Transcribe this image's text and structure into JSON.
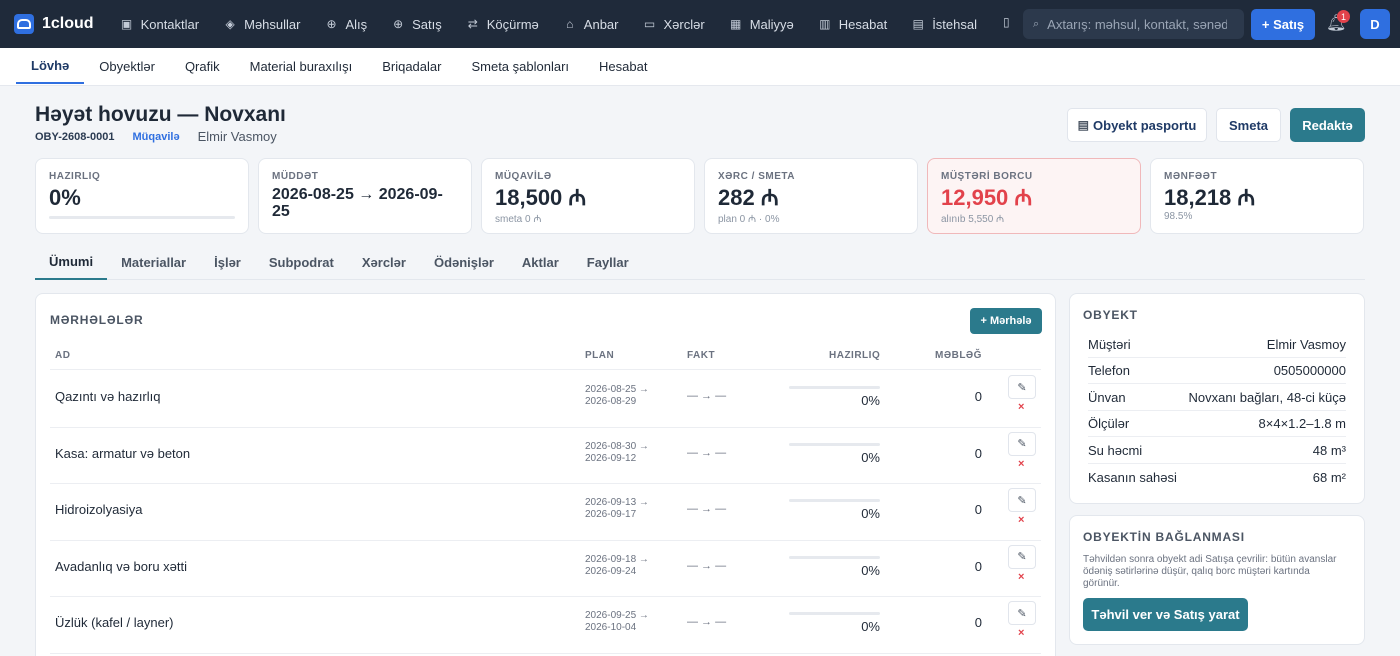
{
  "app": {
    "brand": "1cloud"
  },
  "topnav": [
    {
      "label": "Kontaktlar",
      "icon": "contacts-icon",
      "glyph": "▣"
    },
    {
      "label": "Məhsullar",
      "icon": "box-icon",
      "glyph": "◈"
    },
    {
      "label": "Alış",
      "icon": "arrow-down-circle-icon",
      "glyph": "⊕"
    },
    {
      "label": "Satış",
      "icon": "arrow-up-circle-icon",
      "glyph": "⊕"
    },
    {
      "label": "Köçürmə",
      "icon": "transfer-icon",
      "glyph": "⇄"
    },
    {
      "label": "Anbar",
      "icon": "warehouse-icon",
      "glyph": "⌂"
    },
    {
      "label": "Xərclər",
      "icon": "card-icon",
      "glyph": "▭"
    },
    {
      "label": "Maliyyə",
      "icon": "grid-icon",
      "glyph": "▦"
    },
    {
      "label": "Hesabat",
      "icon": "report-icon",
      "glyph": "▥"
    },
    {
      "label": "İstehsal",
      "icon": "factory-icon",
      "glyph": "▤"
    }
  ],
  "search": {
    "placeholder": "Axtarış: məhsul, kontakt, sənəd..."
  },
  "sale_button": "+ Satış",
  "notifications": {
    "count": "1"
  },
  "user": {
    "initial": "D"
  },
  "subnav": [
    "Lövhə",
    "Obyektlər",
    "Qrafik",
    "Material buraxılışı",
    "Briqadalar",
    "Smeta şablonları",
    "Hesabat"
  ],
  "header": {
    "title": "Həyət hovuzu — Novxanı",
    "code": "OBY-2608-0001",
    "status": "Müqavilə",
    "client": "Elmir Vasmoy",
    "btn_passport": "Obyekt pasportu",
    "btn_estimate": "Smeta",
    "btn_edit": "Redaktə"
  },
  "kpis": [
    {
      "label": "HAZIRLIQ",
      "value": "0%",
      "progress": 0
    },
    {
      "label": "MÜDDƏT",
      "value": "2026-08-25 → 2026-09-25"
    },
    {
      "label": "MÜQAVİLƏ",
      "value": "18,500 ₼",
      "sub": "smeta 0 ₼"
    },
    {
      "label": "XƏRC / SMETA",
      "value": "282 ₼",
      "sub": "plan 0 ₼ · 0%"
    },
    {
      "label": "MÜŞTƏRİ BORCU",
      "value": "12,950 ₼",
      "sub": "alınıb 5,550 ₼"
    },
    {
      "label": "MƏNFƏƏT",
      "value": "18,218 ₼",
      "sub": "98.5%"
    }
  ],
  "tabs": [
    "Ümumi",
    "Materiallar",
    "İşlər",
    "Subpodrat",
    "Xərclər",
    "Ödənişlər",
    "Aktlar",
    "Fayllar"
  ],
  "phases": {
    "title": "MƏRHƏLƏLƏR",
    "add_label": "+ Mərhələ",
    "headers": {
      "name": "AD",
      "plan": "PLAN",
      "fact": "FAKT",
      "ready": "HAZIRLIQ",
      "amount": "MƏBLƏĞ"
    },
    "rows": [
      {
        "name": "Qazıntı və hazırlıq",
        "plan_from": "2026-08-25 →",
        "plan_to": "2026-08-29",
        "fact": "— → —",
        "progress": 0,
        "pct": "0%",
        "amount": "0"
      },
      {
        "name": "Kasa: armatur və beton",
        "plan_from": "2026-08-30 →",
        "plan_to": "2026-09-12",
        "fact": "— → —",
        "progress": 0,
        "pct": "0%",
        "amount": "0"
      },
      {
        "name": "Hidroizolyasiya",
        "plan_from": "2026-09-13 →",
        "plan_to": "2026-09-17",
        "fact": "— → —",
        "progress": 0,
        "pct": "0%",
        "amount": "0"
      },
      {
        "name": "Avadanlıq və boru xətti",
        "plan_from": "2026-09-18 →",
        "plan_to": "2026-09-24",
        "fact": "— → —",
        "progress": 0,
        "pct": "0%",
        "amount": "0"
      },
      {
        "name": "Üzlük (kafel / layner)",
        "plan_from": "2026-09-25 →",
        "plan_to": "2026-10-04",
        "fact": "— → —",
        "progress": 0,
        "pct": "0%",
        "amount": "0"
      }
    ],
    "edit_glyph": "✎",
    "delete_glyph": "×"
  },
  "object": {
    "title": "OBYEKT",
    "rows": [
      {
        "key": "Müştəri",
        "value": "Elmir Vasmoy"
      },
      {
        "key": "Telefon",
        "value": "0505000000"
      },
      {
        "key": "Ünvan",
        "value": "Novxanı bağları, 48-ci küçə"
      },
      {
        "key": "Ölçülər",
        "value": "8×4×1.2–1.8 m"
      },
      {
        "key": "Su həcmi",
        "value": "48 m³"
      },
      {
        "key": "Kasanın sahəsi",
        "value": "68 m²"
      }
    ]
  },
  "link": {
    "title": "OBYEKTİN BAĞLANMASI",
    "desc": "Təhvildən sonra obyekt adi Satışa çevrilir: bütün avanslar ödəniş sətirlərinə düşür, qalıq borc müştəri kartında görünür.",
    "button": "Təhvil ver və Satış yarat"
  }
}
